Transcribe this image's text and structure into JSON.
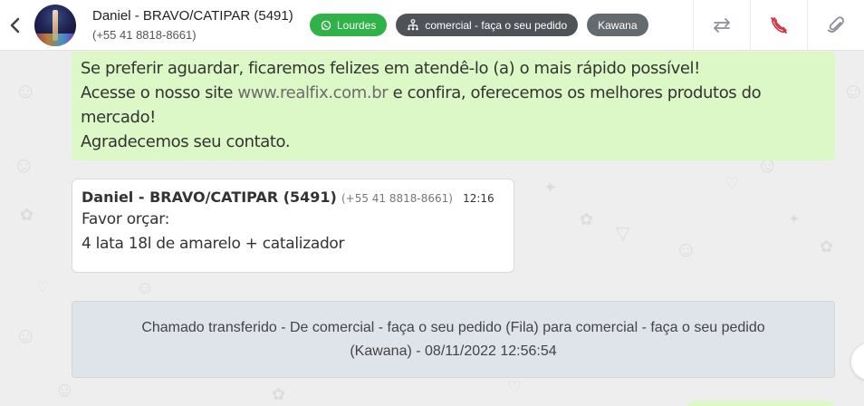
{
  "header": {
    "contact_name": "Daniel - BRAVO/CATIPAR (5491)",
    "contact_phone": "(+55 41 8818-8661)",
    "agent_tag": "Lourdes",
    "queue_tag": "comercial - faça o seu pedido",
    "assignee_tag": "Kawana",
    "agent_icon": "whatsapp-icon",
    "queue_icon": "sitemap-icon",
    "actions": [
      "transfer-icon",
      "end-call-icon",
      "attach-icon"
    ]
  },
  "colors": {
    "outgoing_bubble": "#dcf8c6",
    "agent_tag": "#2fb247",
    "queue_tag": "#4f5358",
    "assignee_tag": "#636a70",
    "end_call_icon": "#d32f3f"
  },
  "messages": {
    "outgoing": {
      "line1": "Se preferir aguardar, ficaremos felizes em atendê-lo (a) o mais rápido possível!",
      "line2_pre": "Acesse o nosso site ",
      "line2_link": "www.realfix.com.br",
      "line2_post": " e confira, oferecemos os melhores produtos do",
      "line3": "mercado!",
      "line4": "Agradecemos seu contato."
    },
    "incoming": {
      "sender": "Daniel - BRAVO/CATIPAR (5491)",
      "phone": "(+55 41 8818-8661)",
      "time": "12:16",
      "line1": "Favor orçar:",
      "line2": "4 lata 18l de amarelo + catalizador"
    },
    "system": {
      "line1": "Chamado transferido - De comercial - faça o seu pedido (Fila) para comercial - faça o seu pedido",
      "line2": "(Kawana) - 08/11/2022 12:56:54"
    }
  }
}
